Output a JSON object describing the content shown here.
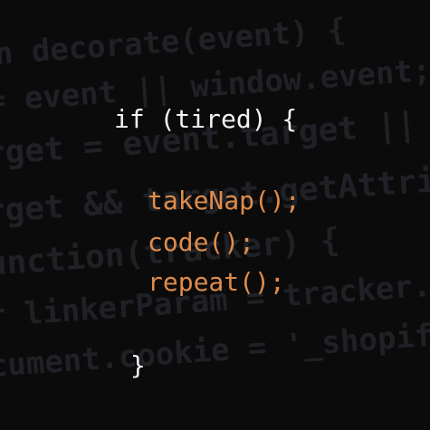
{
  "background_code": {
    "lines": [
      "n decorate(event) {",
      "= event || window.event;",
      "rget = event.target || event.sr",
      "rget && target.getAttribute('a",
      "unction(tracker) {",
      "r linkerParam = tracker.get('lin",
      "cument.cookie = '_shopify_ga='"
    ],
    "color": "#1f2126"
  },
  "code": {
    "condition_line": "if (tired) {",
    "body": [
      "takeNap();",
      "code();",
      "repeat();"
    ],
    "closing_brace": "}",
    "keyword_color": "#f2f2f2",
    "call_color": "#e08c4a"
  }
}
